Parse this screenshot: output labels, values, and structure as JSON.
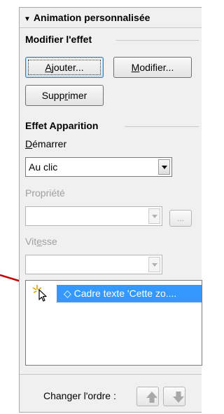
{
  "panel": {
    "header_title": "Animation personnalisée"
  },
  "modify_effect": {
    "title": "Modifier l'effet",
    "add_button": {
      "before": "",
      "underline": "A",
      "after": "jouter..."
    },
    "modify_button": {
      "before": "",
      "underline": "M",
      "after": "odifier..."
    },
    "delete_button": {
      "before": "Supp",
      "underline": "r",
      "after": "imer"
    }
  },
  "effect": {
    "title": "Effet Apparition",
    "start_label": {
      "before": "",
      "underline": "D",
      "after": "émarrer"
    },
    "start_value": "Au clic",
    "property_label": "Propriété",
    "property_value": "",
    "property_more_button": "...",
    "speed_label": {
      "before": "Vit",
      "underline": "e",
      "after": "sse"
    },
    "speed_value": ""
  },
  "effect_list": {
    "items": [
      {
        "icon": "click-trigger-icon",
        "label": "◇ Cadre texte 'Cette zo....",
        "selected": true
      }
    ]
  },
  "order": {
    "label": "Changer l'ordre :",
    "up_icon": "arrow-up-icon",
    "down_icon": "arrow-down-icon"
  },
  "colors": {
    "selection": "#3399ff",
    "pointer_line": "#c00000"
  }
}
